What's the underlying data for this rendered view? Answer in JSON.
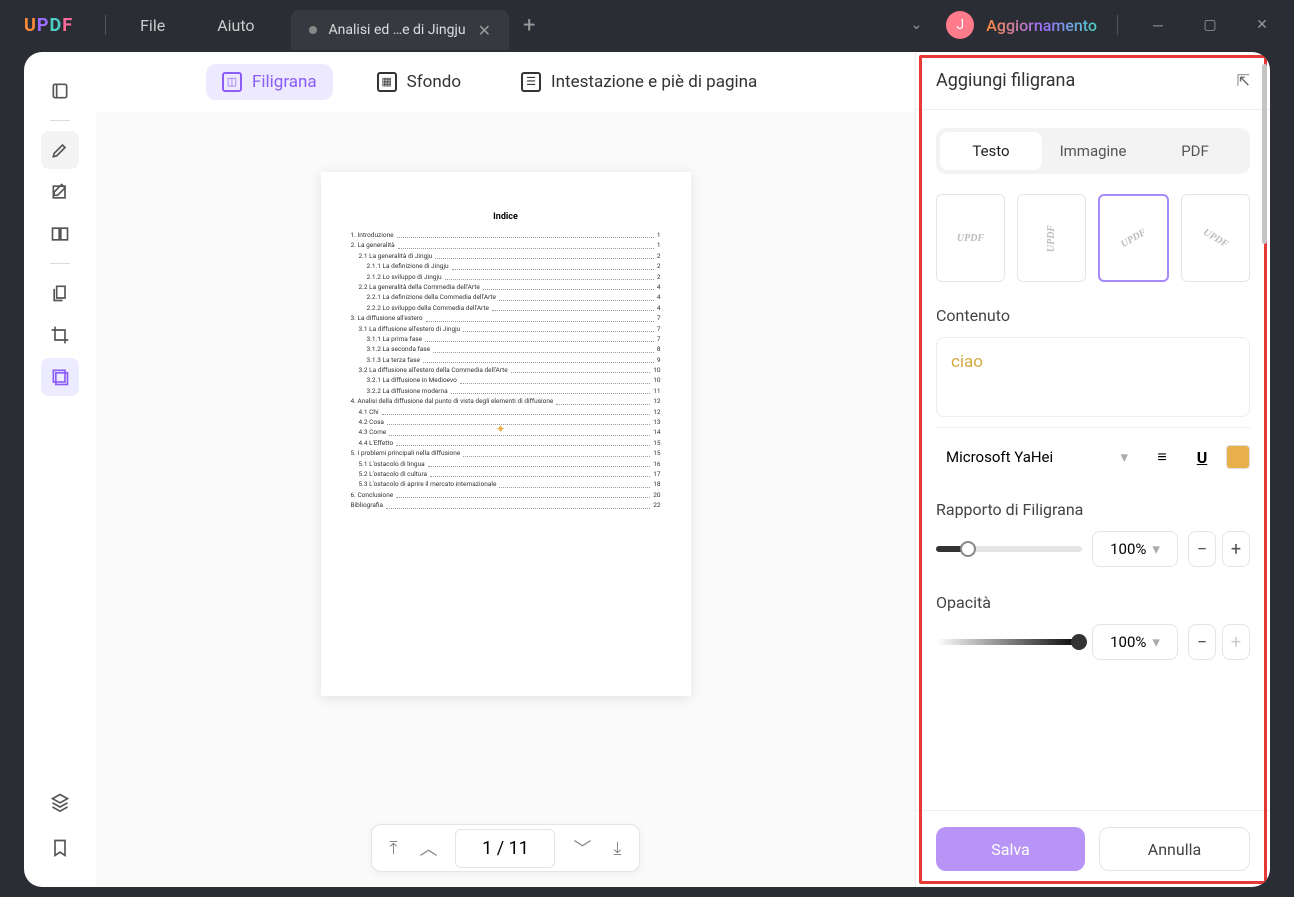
{
  "titlebar": {
    "logo_chars": [
      "U",
      "P",
      "D",
      "F"
    ],
    "menu_file": "File",
    "menu_help": "Aiuto",
    "tab_title": "Analisi ed …e di Jingju",
    "avatar_letter": "J",
    "upgrade": "Aggiornamento"
  },
  "top_tabs": {
    "watermark": "Filigrana",
    "background": "Sfondo",
    "header_footer": "Intestazione e piè di pagina"
  },
  "document": {
    "page_title": "Indice",
    "toc": [
      {
        "t": "1. Introduzione",
        "p": "1"
      },
      {
        "t": "2. La generalità",
        "p": "1"
      },
      {
        "t": "2.1 La generalità di Jingju",
        "p": "2"
      },
      {
        "t": "2.1.1 La definizione di Jingju",
        "p": "2"
      },
      {
        "t": "2.1.2 Lo sviluppo di Jingju",
        "p": "2"
      },
      {
        "t": "2.2 La generalità della Commedia dell'Arte",
        "p": "4"
      },
      {
        "t": "2.2.1 La definizione della Commedia dell'Arte",
        "p": "4"
      },
      {
        "t": "2.2.2 Lo sviluppo della Commedia dell'Arte",
        "p": "4"
      },
      {
        "t": "3. La diffusione all'estero",
        "p": "7"
      },
      {
        "t": "3.1 La diffusione all'estero di Jingju",
        "p": "7"
      },
      {
        "t": "3.1.1 La prima fase",
        "p": "7"
      },
      {
        "t": "3.1.2 La seconda fase",
        "p": "8"
      },
      {
        "t": "3.1.3 La terza fase",
        "p": "9"
      },
      {
        "t": "3.2 La diffusione all'estero della Commedia dell'Arte",
        "p": "10"
      },
      {
        "t": "3.2.1 La diffusione in Medioevo",
        "p": "10"
      },
      {
        "t": "3.2.2 La diffusione moderna",
        "p": "11"
      },
      {
        "t": "4. Analisi della diffusione dal punto di vista degli elementi di diffusione",
        "p": "12"
      },
      {
        "t": "4.1 Chi",
        "p": "12"
      },
      {
        "t": "4.2 Cosa",
        "p": "13"
      },
      {
        "t": "4.3 Come",
        "p": "14"
      },
      {
        "t": "4.4 L'Effetto",
        "p": "15"
      },
      {
        "t": "5. I problemi principali nella diffusione",
        "p": "15"
      },
      {
        "t": "5.1 L'ostacolo di lingua",
        "p": "16"
      },
      {
        "t": "5.2 L'ostacolo di cultura",
        "p": "17"
      },
      {
        "t": "5.3 L'ostacolo di aprire il mercato internazionale",
        "p": "18"
      },
      {
        "t": "6. Conclusione",
        "p": "20"
      },
      {
        "t": "Bibliografia",
        "p": "22"
      }
    ]
  },
  "pager": {
    "display": "1  /  11"
  },
  "panel": {
    "title": "Aggiungi filigrana",
    "tabs": {
      "text": "Testo",
      "image": "Immagine",
      "pdf": "PDF"
    },
    "preset_label": "UPDF",
    "content_label": "Contenuto",
    "content_value": "ciao",
    "font": "Microsoft YaHei",
    "ratio_label": "Rapporto di Filigrana",
    "ratio_value": "100%",
    "opacity_label": "Opacità",
    "opacity_value": "100%",
    "save": "Salva",
    "cancel": "Annulla"
  }
}
